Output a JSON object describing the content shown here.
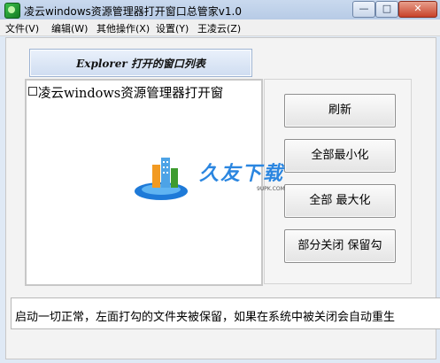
{
  "window": {
    "title": "凌云windows资源管理器打开窗口总管家v1.0",
    "min_glyph": "—",
    "max_glyph": "□",
    "close_glyph": "✕"
  },
  "menu": {
    "items": [
      {
        "label": "文件(V)"
      },
      {
        "label": "编辑(W)"
      },
      {
        "label": "其他操作(X)"
      },
      {
        "label": "设置(Y)"
      },
      {
        "label": "王凌云(Z)"
      }
    ]
  },
  "explorer_list": {
    "header": "Explorer 打开的窗口列表",
    "items": [
      {
        "label": "凌云windows资源管理器打开窗",
        "checked": false
      }
    ]
  },
  "actions": {
    "refresh": "刷新",
    "minimize_all": "全部最小化",
    "maximize_all": "全部 最大化",
    "close_some": "部分关闭 保留勾"
  },
  "status": {
    "text": "启动一切正常，左面打勾的文件夹被保留，如果在系统中被关闭会自动重生"
  },
  "watermark": {
    "text": "久友下载",
    "url": "9UPK.COM"
  },
  "colors": {
    "title_bar": "#c9d9ee",
    "close_button": "#c8422a",
    "watermark_blue": "#2b86e0"
  }
}
